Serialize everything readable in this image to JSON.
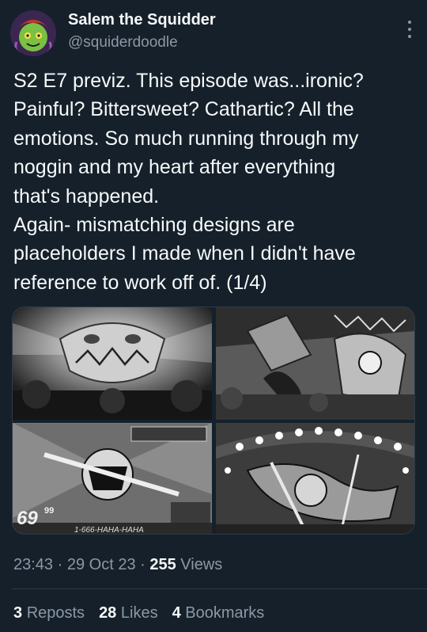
{
  "author": {
    "display_name": "Salem the Squidder",
    "handle": "@squiderdoodle"
  },
  "tweet": {
    "text": "S2 E7 previz. This episode was...ironic?\nPainful? Bittersweet? Cathartic? All the\nemotions. So much running through my\nnoggin and my heart after everything\nthat's happened.\nAgain- mismatching designs are\nplaceholders I made when I didn't have\nreference to work off of. (1/4)"
  },
  "media": {
    "images": [
      {
        "name": "storyboard-frame-1"
      },
      {
        "name": "storyboard-frame-2"
      },
      {
        "name": "storyboard-frame-3",
        "overlay_number": "69",
        "overlay_cents": "99",
        "overlay_phone": "1-666-HAHA-HAHA"
      },
      {
        "name": "storyboard-frame-4"
      }
    ]
  },
  "meta": {
    "time": "23:43",
    "sep1": " · ",
    "date": "29 Oct 23",
    "sep2": " · ",
    "views_count": "255",
    "views_label": " Views"
  },
  "stats": {
    "reposts_count": "3",
    "reposts_label": "Reposts",
    "likes_count": "28",
    "likes_label": "Likes",
    "bookmarks_count": "4",
    "bookmarks_label": "Bookmarks"
  },
  "colors": {
    "background": "#15202b",
    "text_primary": "#f7f9f9",
    "text_secondary": "#8b98a5",
    "border": "#2f3b47"
  }
}
